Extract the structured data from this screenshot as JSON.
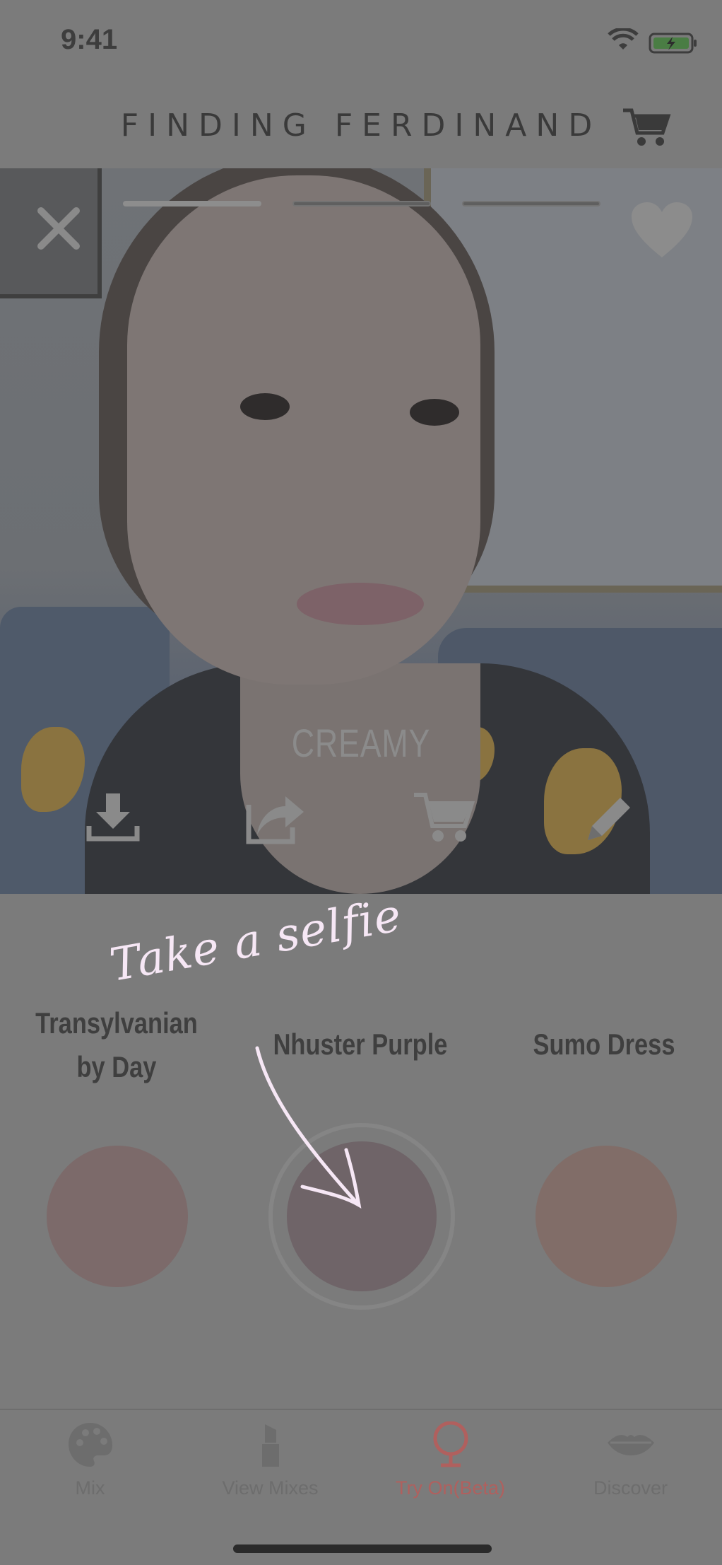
{
  "status_bar": {
    "time": "9:41"
  },
  "header": {
    "brand": "FINDING FERDINAND",
    "cart_icon": "cart-icon"
  },
  "photo": {
    "story_progress": [
      1,
      0,
      0
    ],
    "finish_label": "CREAMY",
    "actions": [
      {
        "name": "download-icon"
      },
      {
        "name": "share-icon"
      },
      {
        "name": "cart-icon"
      },
      {
        "name": "edit-pencil-icon"
      }
    ]
  },
  "shades": [
    {
      "name": "Transylvanian by Day",
      "color": "#7c6a6a",
      "selected": false
    },
    {
      "name": "Nhuster Purple",
      "color": "#6f6468",
      "selected": true
    },
    {
      "name": "Sumo Dress",
      "color": "#816d68",
      "selected": false
    }
  ],
  "annotation": {
    "text": "Take a selfie"
  },
  "tabs": [
    {
      "label": "Mix",
      "icon": "palette-icon",
      "active": false
    },
    {
      "label": "View Mixes",
      "icon": "lipstick-icon",
      "active": false
    },
    {
      "label": "Try On(Beta)",
      "icon": "mirror-icon",
      "active": true
    },
    {
      "label": "Discover",
      "icon": "lips-icon",
      "active": false
    }
  ],
  "colors": {
    "overlay": "#7b7b7b",
    "active_tab": "#b0605e",
    "annotation": "#f6e7f5"
  }
}
